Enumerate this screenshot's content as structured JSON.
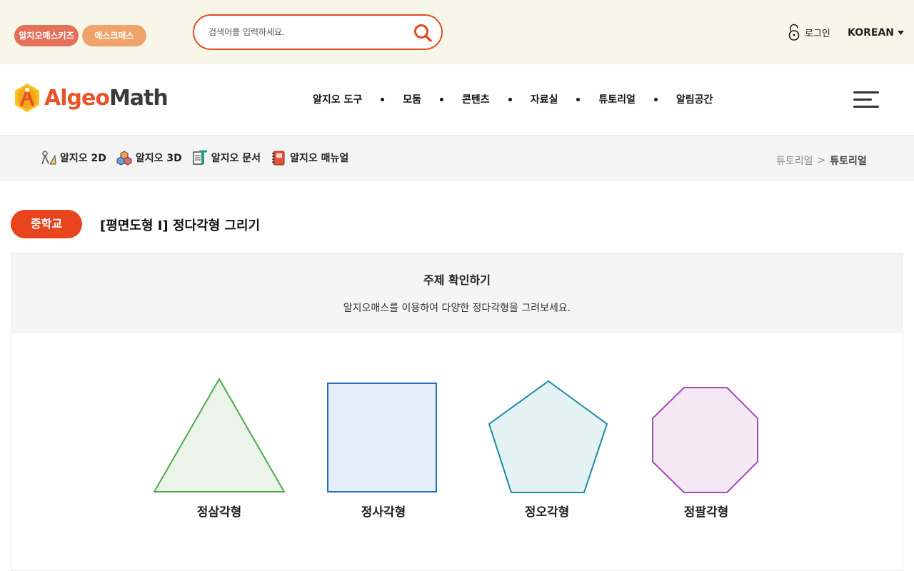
{
  "topbar": {
    "kids_label": "알지오매스키즈",
    "algeomath_label": "애스크매스",
    "search_placeholder": "검색어를 입력하세요.",
    "login_label": "로그인",
    "language_label": "KOREAN"
  },
  "header": {
    "logo_algeo": "Algeo",
    "logo_math": "Math",
    "nav": [
      "알지오 도구",
      "모둠",
      "콘텐츠",
      "자료실",
      "튜토리얼",
      "알림공간"
    ]
  },
  "subnav": {
    "items": [
      "알지오 2D",
      "알지오 3D",
      "알지오 문서",
      "알지오 매뉴얼"
    ]
  },
  "breadcrumb": {
    "parent": "튜토리얼",
    "separator": ">",
    "current": "튜토리얼"
  },
  "title": {
    "level": "중학교",
    "text": "[평면도형 I] 정다각형 그리기"
  },
  "topic": {
    "title": "주제 확인하기",
    "description": "알지오매스를 이용하여 다양한 정다각형을 그려보세요."
  },
  "shapes": [
    {
      "label": "정삼각형",
      "stroke": "#4caa4c",
      "fill": "#eaf4e8"
    },
    {
      "label": "정사각형",
      "stroke": "#1e6fc4",
      "fill": "#e6eef9"
    },
    {
      "label": "정오각형",
      "stroke": "#1c8aa6",
      "fill": "#e5f2f4"
    },
    {
      "label": "정팔각형",
      "stroke": "#9c4cb4",
      "fill": "#f5e8f5"
    }
  ],
  "colors": {
    "accent": "#e8441e",
    "topbar_bg": "#f8f5e9"
  }
}
